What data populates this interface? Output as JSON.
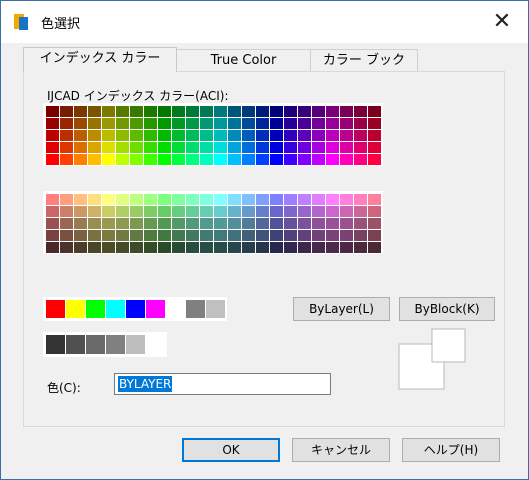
{
  "window": {
    "title": "色選択",
    "close_glyph": "✕"
  },
  "tabs": [
    {
      "label": "インデックス カラー",
      "active": true
    },
    {
      "label": "True Color",
      "active": false
    },
    {
      "label": "カラー ブック",
      "active": false
    }
  ],
  "palette": {
    "label": "IJCAD インデックス カラー(ACI):",
    "top_rows": [
      [
        "#7a0000",
        "#7a1c00",
        "#7a3800",
        "#7a5500",
        "#7a7a00",
        "#557a00",
        "#387a00",
        "#1c7a00",
        "#007a00",
        "#007a1c",
        "#007a38",
        "#007a55",
        "#007a7a",
        "#00557a",
        "#00387a",
        "#001c7a",
        "#00007a",
        "#1c007a",
        "#38007a",
        "#55007a",
        "#7a007a",
        "#7a0055",
        "#7a0038",
        "#7a001c"
      ],
      [
        "#990000",
        "#992600",
        "#994c00",
        "#997300",
        "#999900",
        "#739900",
        "#4c9900",
        "#269900",
        "#009900",
        "#009926",
        "#00994c",
        "#009973",
        "#009999",
        "#007399",
        "#004c99",
        "#002699",
        "#000099",
        "#260099",
        "#4c0099",
        "#730099",
        "#990099",
        "#990073",
        "#99004c",
        "#990026"
      ],
      [
        "#bb0000",
        "#bb2e00",
        "#bb5d00",
        "#bb8c00",
        "#bbbb00",
        "#8cbb00",
        "#5dbb00",
        "#2ebb00",
        "#00bb00",
        "#00bb2e",
        "#00bb5d",
        "#00bb8c",
        "#00bbbb",
        "#008cbb",
        "#005dbb",
        "#002ebb",
        "#0000bb",
        "#2e00bb",
        "#5d00bb",
        "#8c00bb",
        "#bb00bb",
        "#bb008c",
        "#bb005d",
        "#bb002e"
      ],
      [
        "#dd0000",
        "#dd3700",
        "#dd6e00",
        "#dda500",
        "#dddd00",
        "#a5dd00",
        "#6edd00",
        "#37dd00",
        "#00dd00",
        "#00dd37",
        "#00dd6e",
        "#00dda5",
        "#00dddd",
        "#00a5dd",
        "#006edd",
        "#0037dd",
        "#0000dd",
        "#3700dd",
        "#6e00dd",
        "#a500dd",
        "#dd00dd",
        "#dd00a5",
        "#dd006e",
        "#dd0037"
      ],
      [
        "#ff0000",
        "#ff4000",
        "#ff8000",
        "#ffbf00",
        "#ffff00",
        "#bfff00",
        "#80ff00",
        "#40ff00",
        "#00ff00",
        "#00ff40",
        "#00ff80",
        "#00ffbf",
        "#00ffff",
        "#00bfff",
        "#0080ff",
        "#0040ff",
        "#0000ff",
        "#4000ff",
        "#8000ff",
        "#bf00ff",
        "#ff00ff",
        "#ff00bf",
        "#ff0080",
        "#ff0040"
      ]
    ],
    "bottom_rows": [
      [
        "#ff7f7f",
        "#ff9f7f",
        "#ffbf7f",
        "#ffdf7f",
        "#ffff7f",
        "#dfff7f",
        "#bfff7f",
        "#9fff7f",
        "#7fff7f",
        "#7fff9f",
        "#7fffbf",
        "#7fffdf",
        "#7fffff",
        "#7fdfff",
        "#7fbfff",
        "#7f9fff",
        "#7f7fff",
        "#9f7fff",
        "#bf7fff",
        "#df7fff",
        "#ff7fff",
        "#ff7fdf",
        "#ff7fbf",
        "#ff7f9f"
      ],
      [
        "#cc6666",
        "#cc7f66",
        "#cc9966",
        "#ccb266",
        "#cccc66",
        "#b2cc66",
        "#99cc66",
        "#7fcc66",
        "#66cc66",
        "#66cc7f",
        "#66cc99",
        "#66ccb2",
        "#66cccc",
        "#66b2cc",
        "#6699cc",
        "#667fcc",
        "#6666cc",
        "#7f66cc",
        "#9966cc",
        "#b266cc",
        "#cc66cc",
        "#cc66b2",
        "#cc6699",
        "#cc667f"
      ],
      [
        "#995252",
        "#996652",
        "#997a52",
        "#998e52",
        "#999952",
        "#8e9952",
        "#7a9952",
        "#669952",
        "#529952",
        "#529966",
        "#52997a",
        "#52998e",
        "#529999",
        "#528e99",
        "#527a99",
        "#526699",
        "#525299",
        "#665299",
        "#7a5299",
        "#8e5299",
        "#995299",
        "#99528e",
        "#99527a",
        "#995266"
      ],
      [
        "#7a4141",
        "#7a5141",
        "#7a6141",
        "#7a7141",
        "#7a7a41",
        "#717a41",
        "#617a41",
        "#517a41",
        "#417a41",
        "#417a51",
        "#417a61",
        "#417a71",
        "#417a7a",
        "#41717a",
        "#41617a",
        "#41517a",
        "#41417a",
        "#51417a",
        "#61417a",
        "#71417a",
        "#7a417a",
        "#7a4171",
        "#7a4161",
        "#7a4151"
      ],
      [
        "#4c2828",
        "#4c3328",
        "#4c3d28",
        "#4c4628",
        "#4c4c28",
        "#464c28",
        "#3d4c28",
        "#334c28",
        "#284c28",
        "#284c33",
        "#284c3d",
        "#284c46",
        "#284c4c",
        "#28464c",
        "#283d4c",
        "#28334c",
        "#28284c",
        "#33284c",
        "#3d284c",
        "#46284c",
        "#4c284c",
        "#4c2846",
        "#4c283d",
        "#4c2833"
      ]
    ],
    "standard": [
      "#ff0000",
      "#ffff00",
      "#00ff00",
      "#00ffff",
      "#0000ff",
      "#ff00ff",
      "#ffffff",
      "#808080",
      "#c0c0c0"
    ],
    "grays": [
      "#333333",
      "#505050",
      "#696969",
      "#808080",
      "#bebebe",
      "#ffffff"
    ]
  },
  "buttons": {
    "bylayer": "ByLayer(L)",
    "byblock": "ByBlock(K)",
    "ok": "OK",
    "cancel": "キャンセル",
    "help": "ヘルプ(H)"
  },
  "color_field": {
    "label": "色(C):",
    "value": "BYLAYER"
  }
}
